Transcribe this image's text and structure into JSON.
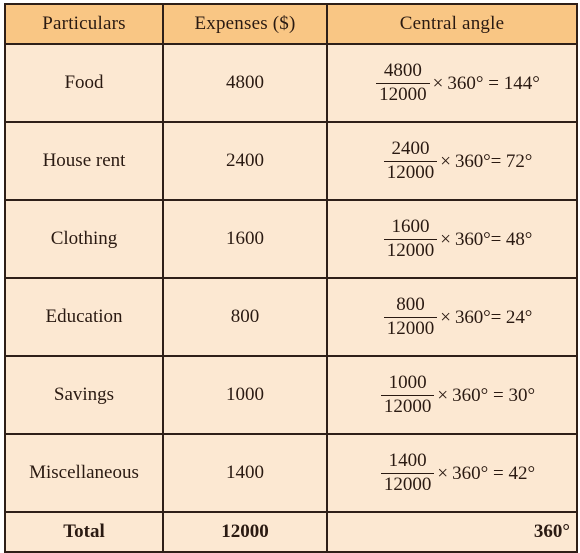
{
  "table": {
    "headers": {
      "particulars": "Particulars",
      "expenses": "Expenses ($)",
      "central_angle": "Central angle"
    },
    "rows": [
      {
        "particulars": "Food",
        "expenses": "4800",
        "angle": {
          "numerator": "4800",
          "denominator": "12000",
          "times": "×",
          "rest": "360° = 144°",
          "result": "144°",
          "spacing": "loose"
        }
      },
      {
        "particulars": "House rent",
        "expenses": "2400",
        "angle": {
          "numerator": "2400",
          "denominator": "12000",
          "times": "×",
          "rest": "360°= 72°",
          "result": "72°",
          "spacing": "tight"
        }
      },
      {
        "particulars": "Clothing",
        "expenses": "1600",
        "angle": {
          "numerator": "1600",
          "denominator": "12000",
          "times": "×",
          "rest": "360°= 48°",
          "result": "48°",
          "spacing": "tight"
        }
      },
      {
        "particulars": "Education",
        "expenses": "800",
        "angle": {
          "numerator": "800",
          "denominator": "12000",
          "times": "×",
          "rest": "360°= 24°",
          "result": "24°",
          "spacing": "tight"
        }
      },
      {
        "particulars": "Savings",
        "expenses": "1000",
        "angle": {
          "numerator": "1000",
          "denominator": "12000",
          "times": "×",
          "rest": "360° = 30°",
          "result": "30°",
          "spacing": "loose"
        }
      },
      {
        "particulars": "Miscellaneous",
        "expenses": "1400",
        "angle": {
          "numerator": "1400",
          "denominator": "12000",
          "times": "×",
          "rest": "360° = 42°",
          "result": "42°",
          "spacing": "loose"
        }
      }
    ],
    "total": {
      "label": "Total",
      "expenses": "12000",
      "angle": "360°"
    }
  },
  "colors": {
    "header_background": "#f9c684",
    "body_background": "#fce8d2",
    "border": "#2e1f18",
    "text": "#2a1a12",
    "page_background": "#ffffff"
  }
}
